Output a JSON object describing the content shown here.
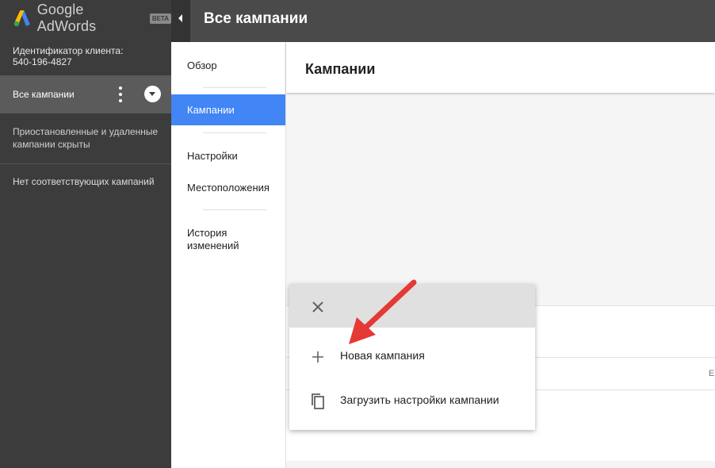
{
  "app": {
    "logo_text": "Google AdWords",
    "beta_badge": "BETA"
  },
  "sidebar": {
    "client_label": "Идентификатор клиента:",
    "client_id": "540-196-4827",
    "all_campaigns": "Все кампании",
    "hidden_note": "Приостановленные и удаленные кампании скрыты",
    "no_match": "Нет соответствующих кампаний"
  },
  "header": {
    "title": "Все кампании"
  },
  "subnav": {
    "items": [
      {
        "label": "Обзор"
      },
      {
        "label": "Кампании"
      },
      {
        "label": "Настройки"
      },
      {
        "label": "Местоположения"
      },
      {
        "label": "История изменений"
      }
    ]
  },
  "main": {
    "title": "Кампании",
    "cut_letter": "E"
  },
  "popup": {
    "items": [
      {
        "label": "Новая кампания",
        "icon": "plus-icon"
      },
      {
        "label": "Загрузить настройки кампании",
        "icon": "copy-icon"
      }
    ]
  },
  "colors": {
    "accent": "#4285f4",
    "sidebar_bg": "#3c3c3c",
    "annotation_arrow": "#e53935"
  }
}
